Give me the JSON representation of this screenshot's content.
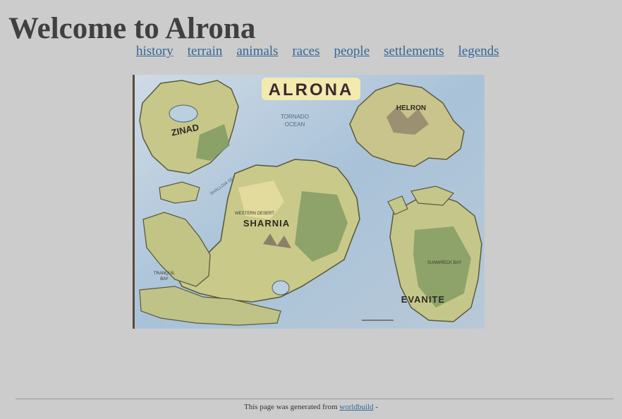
{
  "header": {
    "title": "Welcome to Alrona"
  },
  "nav": {
    "items": [
      "history",
      "terrain",
      "animals",
      "races",
      "people",
      "settlements",
      "legends"
    ]
  },
  "map": {
    "title": "ALRONA",
    "labels": {
      "zinad": "ZINAD",
      "helron": "HELRON",
      "sharnia": "SHARNIA",
      "evanite": "EVANITE",
      "tornado_ocean_1": "TORNADO",
      "tornado_ocean_2": "OCEAN",
      "shallow_seas": "SHALLOW SEAS",
      "tranquil_1": "TRANQUIL",
      "tranquil_2": "BAY",
      "sunwreck": "SUNWRECK BAY",
      "western_desert": "WESTERN DESERT"
    },
    "colors": {
      "sea": "#a9c2d8",
      "land": "#c9c98a",
      "forest": "#7f9a62",
      "sand": "#e6dca0"
    }
  },
  "footer": {
    "text_before": "This page was generated from",
    "link": "worldbuild",
    "text_after": "-"
  }
}
